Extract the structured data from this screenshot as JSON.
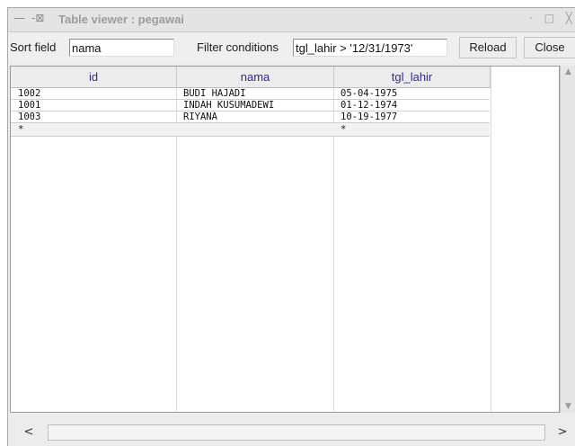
{
  "window": {
    "menu_icon": "—",
    "pin_icon": "-⊠",
    "title": "Table viewer : pegawai",
    "controls": [
      "·",
      "□",
      "╳"
    ]
  },
  "toolbar": {
    "sort_label": "Sort field",
    "sort_value": "nama",
    "filter_label": "Filter conditions",
    "filter_value": "tgl_lahir > '12/31/1973'",
    "reload_label": "Reload",
    "close_label": "Close"
  },
  "table": {
    "columns": [
      "id",
      "nama",
      "tgl_lahir"
    ],
    "rows": [
      [
        "1002",
        "BUDI HAJADI",
        "05-04-1975"
      ],
      [
        "1001",
        "INDAH KUSUMADEWI",
        "01-12-1974"
      ],
      [
        "1003",
        "RIYANA",
        "10-19-1977"
      ]
    ],
    "new_row_marker": [
      "*",
      "",
      "*"
    ]
  },
  "scroll": {
    "left": "<",
    "right": ">",
    "up": "▲",
    "down": "▼"
  }
}
